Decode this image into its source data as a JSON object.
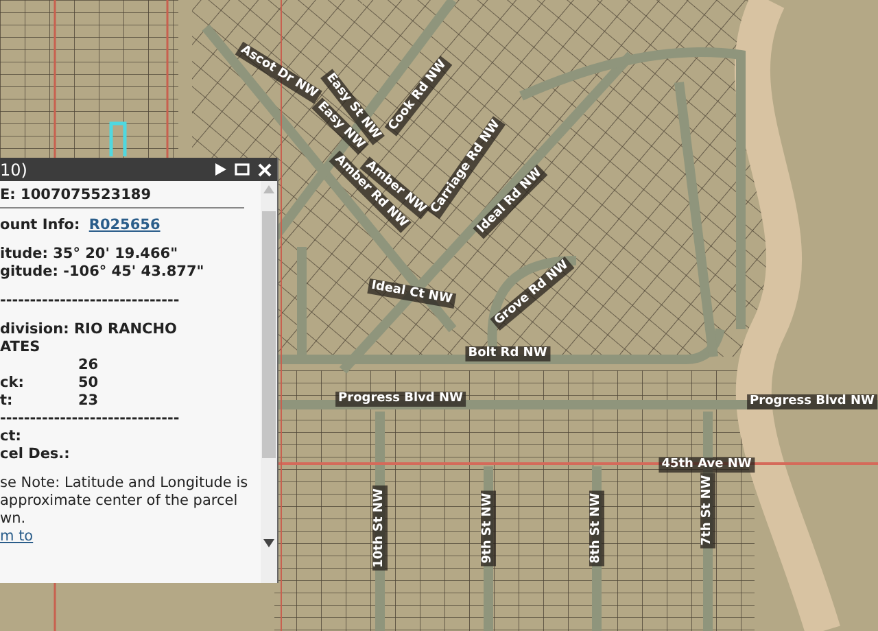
{
  "map": {
    "labels": [
      {
        "text": "Ascot Dr NW"
      },
      {
        "text": "Easy St NW"
      },
      {
        "text": "Easy NW"
      },
      {
        "text": "Cook Rd NW"
      },
      {
        "text": "Amber Rd NW"
      },
      {
        "text": "Amber NW"
      },
      {
        "text": "Carriage Rd NW"
      },
      {
        "text": "Ideal Rd NW"
      },
      {
        "text": "Ideal Ct NW"
      },
      {
        "text": "Grove Rd NW"
      },
      {
        "text": "Bolt Rd NW"
      },
      {
        "text": "Progress Blvd NW"
      },
      {
        "text": "Progress Blvd NW"
      },
      {
        "text": "45th Ave NW"
      },
      {
        "text": "10th St NW"
      },
      {
        "text": "9th St NW"
      },
      {
        "text": "8th St NW"
      },
      {
        "text": "7th St NW"
      }
    ]
  },
  "popup": {
    "title": "10)",
    "lines": [
      {
        "kind": "text",
        "text": "E: 1007075523189"
      },
      {
        "kind": "divider"
      },
      {
        "kind": "link_row",
        "label": "ount Info: ",
        "link": "R025656"
      },
      {
        "kind": "gap"
      },
      {
        "kind": "text",
        "text": "itude: 35° 20' 19.466\""
      },
      {
        "kind": "text",
        "text": "gitude: -106° 45' 43.877\""
      },
      {
        "kind": "gap"
      },
      {
        "kind": "text",
        "text": "------------------------------"
      },
      {
        "kind": "gap"
      },
      {
        "kind": "text",
        "text": "division: RIO RANCHO"
      },
      {
        "kind": "text",
        "text": "ATES"
      },
      {
        "kind": "pair",
        "value": "26"
      },
      {
        "kind": "pair",
        "label": "ck:",
        "value": "50"
      },
      {
        "kind": "pair",
        "label": "t:",
        "value": "23"
      },
      {
        "kind": "text",
        "text": "------------------------------"
      },
      {
        "kind": "text",
        "text": "ct:"
      },
      {
        "kind": "text",
        "text": "cel Des.:"
      },
      {
        "kind": "gap"
      },
      {
        "kind": "note",
        "text": "se Note: Latitude and Longitude is approximate center of the parcel wn."
      },
      {
        "kind": "link",
        "text": "m to"
      }
    ]
  }
}
